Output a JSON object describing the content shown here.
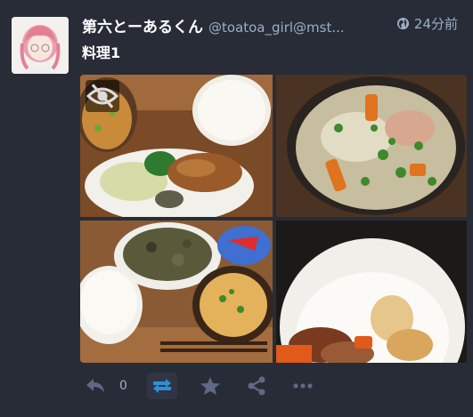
{
  "status": {
    "display_name": "第六とーあるくん",
    "acct": "@toatoa_girl@mst...",
    "relative_time": "24分前",
    "content": "料理1",
    "replies_count": "0"
  },
  "icons": {
    "visibility": "globe-icon",
    "hide_media": "eye-slash-icon",
    "reply": "reply-icon",
    "boost": "retweet-icon",
    "favourite": "star-icon",
    "share": "share-icon",
    "more": "ellipsis-icon"
  },
  "colors": {
    "background": "#282c37",
    "secondary_text": "#9baec8",
    "action_icon": "#606984",
    "boost_active": "#2b90d9"
  }
}
